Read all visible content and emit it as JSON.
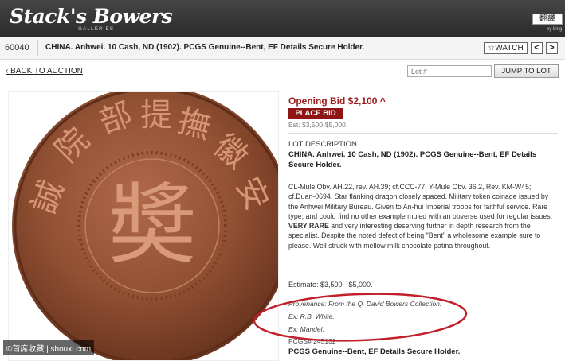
{
  "header": {
    "logo": "Stack's Bowers",
    "logo_sub": "GALLERIES",
    "translate_label": "翻譯",
    "bing_label": "by bing"
  },
  "lot": {
    "number": "60040",
    "title": "CHINA. Anhwei. 10 Cash, ND (1902). PCGS Genuine--Bent, EF Details Secure Holder.",
    "watch_label": "☆WATCH",
    "prev_label": "<",
    "next_label": ">"
  },
  "nav": {
    "back_label": "BACK TO AUCTION",
    "lot_placeholder": "Lot #",
    "jump_label": "JUMP TO LOT"
  },
  "bidding": {
    "opening_bid": "Opening Bid $2,100 ^",
    "place_bid_label": "PLACE BID",
    "estimate_short": "Est: $3,500-$5,000"
  },
  "description": {
    "heading": "LOT DESCRIPTION",
    "title": "CHINA. Anhwei. 10 Cash, ND (1902). PCGS Genuine--Bent, EF Details Secure Holder.",
    "body_part1": "CL-Mule Obv. AH.22, rev. AH.39; cf.CCC-77; Y-Mule Obv. 36.2, Rev. KM-W45; cf.Duan-0694. Star flanking dragon closely spaced. Military token coinage issued by the Anhwei Military Bureau. Given to An-hui Imperial troops for faithful service. Rare type, and could find no other example muled with an obverse used for regular issues. ",
    "body_bold": "VERY RARE",
    "body_part2": " and very interesting deserving further in depth research from the specialist. Despite the noted defect of being \"Bent\" a wholesome example sure to please. Well struck with mellow milk chocolate patina throughout.",
    "estimate": "Estimate: $3,500 - $5,000.",
    "provenance": "Provenance: From the Q. David Bowers Collection.",
    "ex1": "Ex: R.B. White.",
    "ex2": "Ex: Mandel.",
    "pcgs_number": "PCGS# 245132",
    "pcgs_desc": "PCGS Genuine--Bent, EF Details Secure Holder."
  },
  "coin": {
    "center_char": "奬",
    "rim_chars": [
      "誠",
      "院",
      "部",
      "提",
      "撫",
      "徽",
      "安"
    ]
  },
  "watermark": "©首席收藏 | shouxi.com",
  "colors": {
    "accent": "#8e1515",
    "oval": "#c0202a",
    "coin": "#8a4a2c"
  }
}
